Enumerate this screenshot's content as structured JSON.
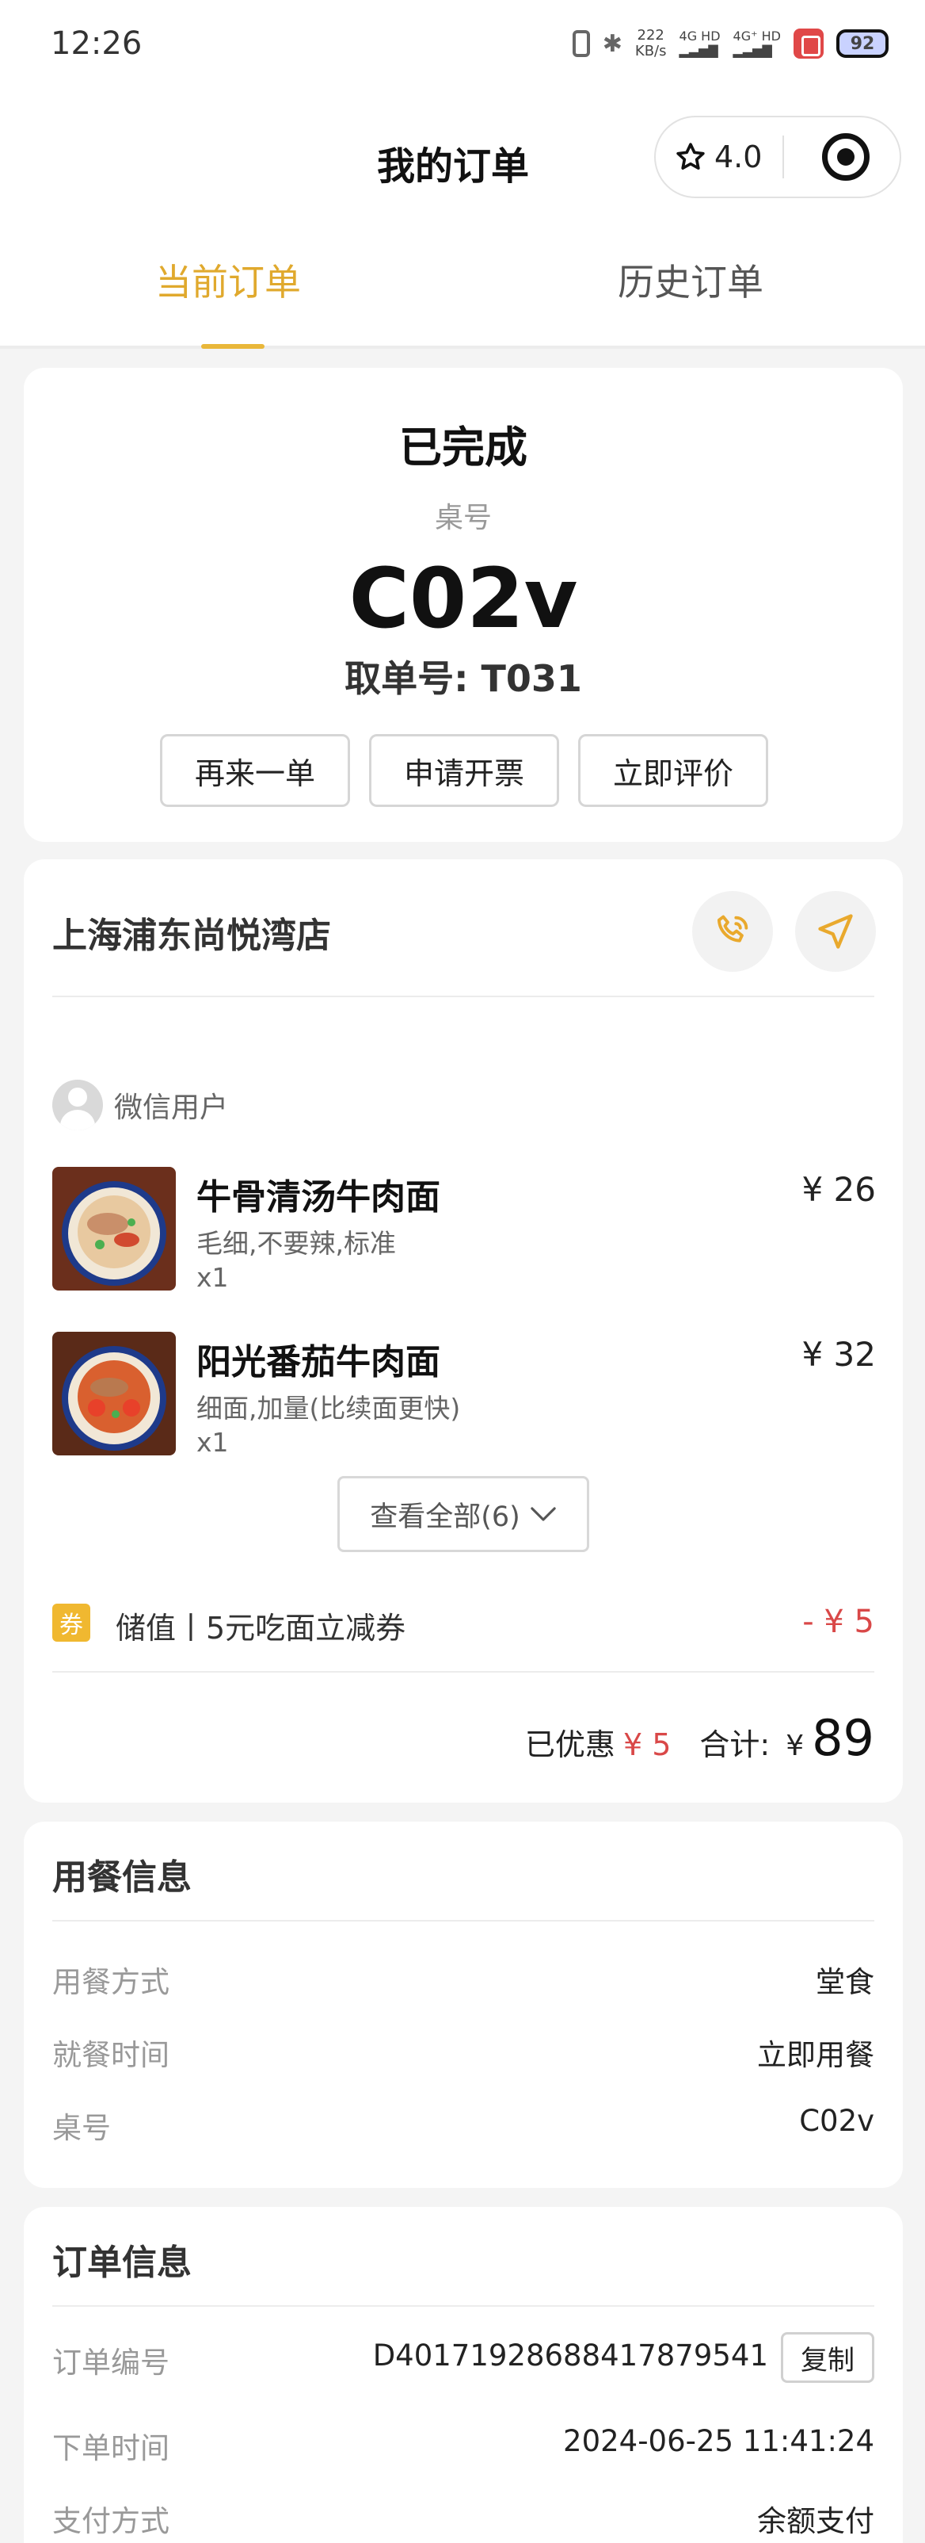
{
  "status_bar": {
    "time": "12:26",
    "net_speed_value": "222",
    "net_speed_unit": "KB/s",
    "signal_1": "4G HD",
    "signal_2": "4G⁺ HD",
    "battery": "92"
  },
  "header": {
    "title": "我的订单",
    "rating": "4.0"
  },
  "tabs": [
    {
      "label": "当前订单",
      "active": true
    },
    {
      "label": "历史订单",
      "active": false
    }
  ],
  "order_status": {
    "status": "已完成",
    "table_label": "桌号",
    "table_number": "C02v",
    "pickup_number": "取单号: T031",
    "actions": [
      "再来一单",
      "申请开票",
      "立即评价"
    ]
  },
  "store": {
    "name": "上海浦东尚悦湾店",
    "user_name": "微信用户"
  },
  "items": [
    {
      "name": "牛骨清汤牛肉面",
      "spec": "毛细,不要辣,标准",
      "qty": "x1",
      "price": "¥ 26"
    },
    {
      "name": "阳光番茄牛肉面",
      "spec": "细面,加量(比续面更快)",
      "qty": "x1",
      "price": "¥ 32"
    }
  ],
  "view_all_label": "查看全部(6)",
  "coupon": {
    "badge": "券",
    "text": "储值丨5元吃面立减券",
    "value": "- ¥ 5"
  },
  "totals": {
    "discount_label": "已优惠",
    "discount_value": "¥ 5",
    "total_label": "合计:",
    "currency": "¥",
    "amount": "89"
  },
  "dining_info": {
    "title": "用餐信息",
    "rows": [
      {
        "key": "用餐方式",
        "value": "堂食"
      },
      {
        "key": "就餐时间",
        "value": "立即用餐"
      },
      {
        "key": "桌号",
        "value": "C02v"
      }
    ]
  },
  "order_info": {
    "title": "订单信息",
    "copy_label": "复制",
    "rows": [
      {
        "key": "订单编号",
        "value": "D40171928688417879541"
      },
      {
        "key": "下单时间",
        "value": "2024-06-25 11:41:24"
      },
      {
        "key": "支付方式",
        "value": "余额支付"
      }
    ]
  },
  "colors": {
    "accent": "#e0a92d",
    "discount_red": "#d94848",
    "background": "#f4f4f4"
  }
}
